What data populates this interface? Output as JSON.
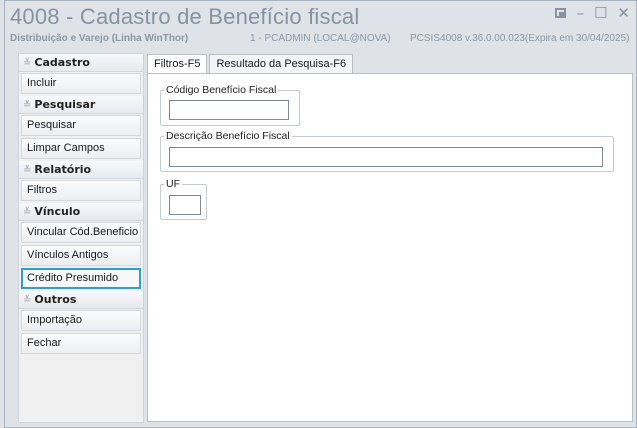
{
  "window": {
    "title": "4008 - Cadastro de Benefício fiscal",
    "subtitle_left": "Distribuição e Varejo (Linha WinThor)",
    "subtitle_user": "1 - PCADMIN (LOCAL@NOVA)",
    "subtitle_version": "PCSIS4008  v.36.0.00.023(Expira em 30/04/2025)",
    "controls": {
      "minimize": "–",
      "maximize": "☐",
      "close": "✕"
    }
  },
  "sidebar": {
    "groups": [
      {
        "title": "Cadastro",
        "items": [
          "Incluir"
        ]
      },
      {
        "title": "Pesquisar",
        "items": [
          "Pesquisar",
          "Limpar Campos"
        ]
      },
      {
        "title": "Relatório",
        "items": [
          "Filtros"
        ]
      },
      {
        "title": "Vínculo",
        "items": [
          "Vincular Cód.Beneficio",
          "Vínculos Antigos",
          "Crédito Presumido"
        ]
      },
      {
        "title": "Outros",
        "items": [
          "Importação",
          "Fechar"
        ]
      }
    ],
    "selected_item": "Crédito Presumido"
  },
  "tabs": [
    "Filtros-F5",
    "Resultado da Pesquisa-F6"
  ],
  "active_tab": "Filtros-F5",
  "filters": {
    "codigo_label": "Código Benefício Fiscal",
    "codigo_value": "",
    "descricao_label": "Descrição Benefício Fiscal",
    "descricao_value": "",
    "uf_label": "UF",
    "uf_value": ""
  }
}
